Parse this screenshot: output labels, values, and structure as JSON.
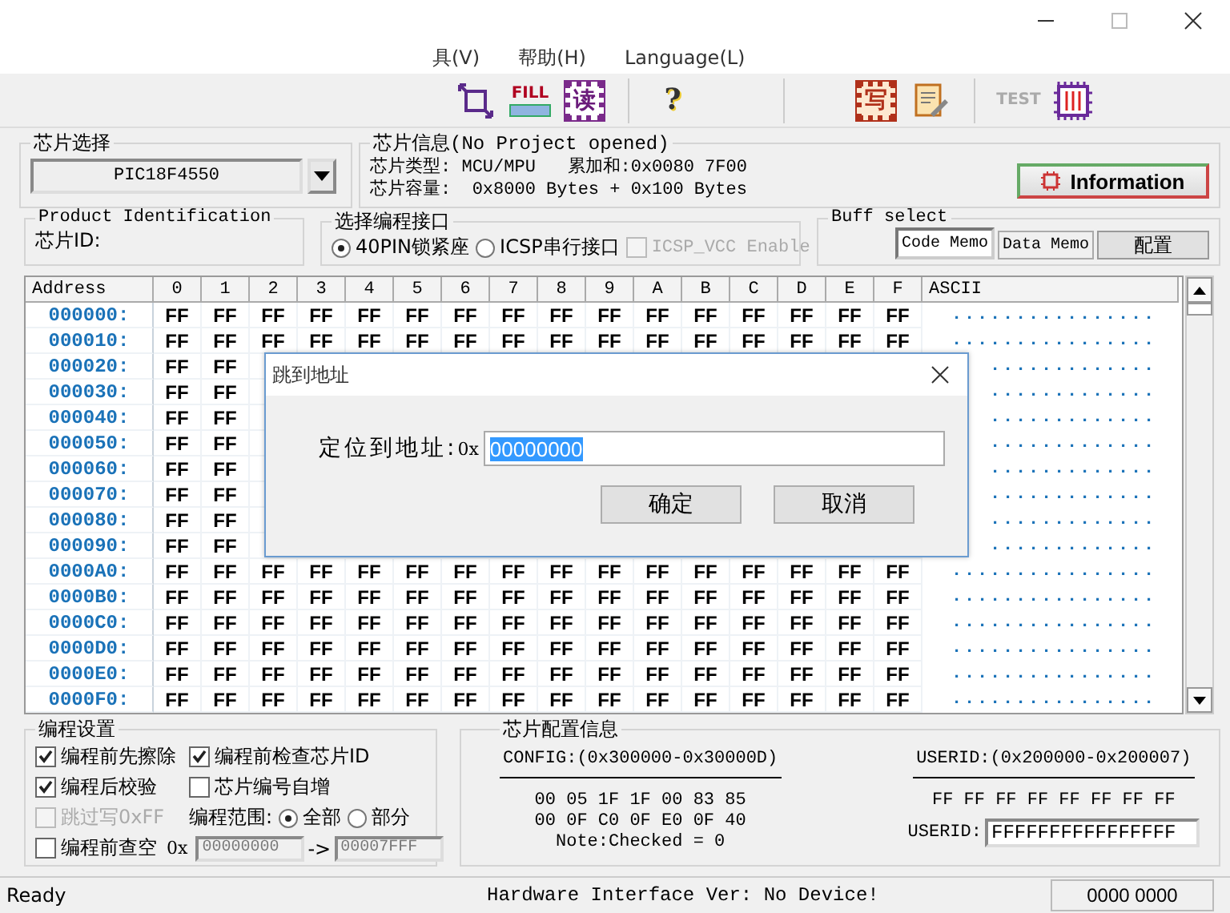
{
  "menu": [
    "具(V)",
    "帮助(H)",
    "Language(L)"
  ],
  "toolbar": [
    {
      "kind": "chip-arrows"
    },
    {
      "kind": "fill",
      "label": "FILL"
    },
    {
      "kind": "read",
      "label": "读"
    },
    {
      "kind": "help",
      "label": "?"
    },
    {
      "kind": "write",
      "label": "写"
    },
    {
      "kind": "edit"
    },
    {
      "kind": "test",
      "label": "TEST",
      "disabled": true
    },
    {
      "kind": "chip"
    }
  ],
  "chip_select": {
    "title": "芯片选择",
    "value": "PIC18F4550"
  },
  "chip_info": {
    "title": "芯片信息(No Project opened)",
    "type_label": "芯片类型:",
    "type_value": "MCU/MPU",
    "checksum": "累加和:0x0080 7F00",
    "capacity_label": "芯片容量:",
    "capacity_value": "0x8000 Bytes + 0x100 Bytes",
    "button": "Information"
  },
  "product_id": {
    "title": "Product Identification",
    "label": "芯片ID:"
  },
  "interface": {
    "title": "选择编程接口",
    "options": [
      {
        "label": "40PIN锁紧座",
        "selected": true
      },
      {
        "label": "ICSP串行接口",
        "selected": false
      }
    ],
    "vcc": {
      "label": "ICSP_VCC Enable",
      "checked": false,
      "disabled": true
    }
  },
  "buff_select": {
    "title": "Buff select",
    "tabs": [
      {
        "label": "Code Memo",
        "selected": true
      },
      {
        "label": "Data Memo",
        "selected": false
      }
    ],
    "button": "配置"
  },
  "hex_table": {
    "columns": [
      "Address",
      "0",
      "1",
      "2",
      "3",
      "4",
      "5",
      "6",
      "7",
      "8",
      "9",
      "A",
      "B",
      "C",
      "D",
      "E",
      "F",
      "ASCII"
    ],
    "rows": [
      {
        "cells": [
          "000000:",
          "FF",
          "FF",
          "FF",
          "FF",
          "FF",
          "FF",
          "FF",
          "FF",
          "FF",
          "FF",
          "FF",
          "FF",
          "FF",
          "FF",
          "FF",
          "FF",
          "................"
        ]
      },
      {
        "cells": [
          "000010:",
          "FF",
          "FF",
          "FF",
          "FF",
          "FF",
          "FF",
          "FF",
          "FF",
          "FF",
          "FF",
          "FF",
          "FF",
          "FF",
          "FF",
          "FF",
          "FF",
          "................"
        ]
      },
      {
        "cells": [
          "000020:",
          "FF",
          "FF",
          null,
          null,
          null,
          null,
          null,
          null,
          null,
          null,
          null,
          null,
          null,
          null,
          null,
          null,
          "............."
        ]
      },
      {
        "cells": [
          "000030:",
          "FF",
          "FF",
          null,
          null,
          null,
          null,
          null,
          null,
          null,
          null,
          null,
          null,
          null,
          null,
          null,
          null,
          "............."
        ]
      },
      {
        "cells": [
          "000040:",
          "FF",
          "FF",
          null,
          null,
          null,
          null,
          null,
          null,
          null,
          null,
          null,
          null,
          null,
          null,
          null,
          null,
          "............."
        ]
      },
      {
        "cells": [
          "000050:",
          "FF",
          "FF",
          null,
          null,
          null,
          null,
          null,
          null,
          null,
          null,
          null,
          null,
          null,
          null,
          null,
          null,
          "............."
        ]
      },
      {
        "cells": [
          "000060:",
          "FF",
          "FF",
          null,
          null,
          null,
          null,
          null,
          null,
          null,
          null,
          null,
          null,
          null,
          null,
          null,
          null,
          "............."
        ]
      },
      {
        "cells": [
          "000070:",
          "FF",
          "FF",
          null,
          null,
          null,
          null,
          null,
          null,
          null,
          null,
          null,
          null,
          null,
          null,
          null,
          null,
          "............."
        ]
      },
      {
        "cells": [
          "000080:",
          "FF",
          "FF",
          null,
          null,
          null,
          null,
          null,
          null,
          null,
          null,
          null,
          null,
          null,
          null,
          null,
          null,
          "............."
        ]
      },
      {
        "cells": [
          "000090:",
          "FF",
          "FF",
          null,
          null,
          null,
          null,
          null,
          null,
          null,
          null,
          null,
          null,
          null,
          null,
          null,
          null,
          "............."
        ]
      },
      {
        "cells": [
          "0000A0:",
          "FF",
          "FF",
          "FF",
          "FF",
          "FF",
          "FF",
          "FF",
          "FF",
          "FF",
          "FF",
          "FF",
          "FF",
          "FF",
          "FF",
          "FF",
          "FF",
          "................"
        ]
      },
      {
        "cells": [
          "0000B0:",
          "FF",
          "FF",
          "FF",
          "FF",
          "FF",
          "FF",
          "FF",
          "FF",
          "FF",
          "FF",
          "FF",
          "FF",
          "FF",
          "FF",
          "FF",
          "FF",
          "................"
        ]
      },
      {
        "cells": [
          "0000C0:",
          "FF",
          "FF",
          "FF",
          "FF",
          "FF",
          "FF",
          "FF",
          "FF",
          "FF",
          "FF",
          "FF",
          "FF",
          "FF",
          "FF",
          "FF",
          "FF",
          "................"
        ]
      },
      {
        "cells": [
          "0000D0:",
          "FF",
          "FF",
          "FF",
          "FF",
          "FF",
          "FF",
          "FF",
          "FF",
          "FF",
          "FF",
          "FF",
          "FF",
          "FF",
          "FF",
          "FF",
          "FF",
          "................"
        ]
      },
      {
        "cells": [
          "0000E0:",
          "FF",
          "FF",
          "FF",
          "FF",
          "FF",
          "FF",
          "FF",
          "FF",
          "FF",
          "FF",
          "FF",
          "FF",
          "FF",
          "FF",
          "FF",
          "FF",
          "................"
        ]
      },
      {
        "cells": [
          "0000F0:",
          "FF",
          "FF",
          "FF",
          "FF",
          "FF",
          "FF",
          "FF",
          "FF",
          "FF",
          "FF",
          "FF",
          "FF",
          "FF",
          "FF",
          "FF",
          "FF",
          "................"
        ]
      }
    ]
  },
  "dialog": {
    "title": "跳到地址",
    "label": "定位到地址:",
    "prefix": "0x",
    "value": "00000000",
    "buttons": [
      "确定",
      "取消"
    ]
  },
  "prog_settings": {
    "title": "编程设置",
    "left_checks": [
      {
        "label": "编程前先擦除",
        "checked": true,
        "disabled": false
      },
      {
        "label": "编程后校验",
        "checked": true,
        "disabled": false
      },
      {
        "label": "跳过写0xFF",
        "checked": false,
        "disabled": true
      },
      {
        "label": "编程前查空",
        "checked": false,
        "disabled": false
      }
    ],
    "right_checks": [
      {
        "label": "编程前检查芯片ID",
        "checked": true,
        "disabled": false
      },
      {
        "label": "芯片编号自增",
        "checked": false,
        "disabled": false
      }
    ],
    "range_label": "编程范围:",
    "range_options": [
      {
        "label": "全部",
        "selected": true
      },
      {
        "label": "部分",
        "selected": false
      }
    ],
    "range_prefix": "0x",
    "range_from": "00000000",
    "range_arrow": "->",
    "range_to": "00007FFF"
  },
  "config_info": {
    "title": "芯片配置信息",
    "config_header": "CONFIG:(0x300000-0x30000D)",
    "config_lines": [
      "00 05 1F 1F 00 83 85",
      "00 0F C0 0F E0 0F 40",
      "Note:Checked = 0"
    ],
    "userid_header": "USERID:(0x200000-0x200007)",
    "userid_bytes": "FF FF FF FF FF FF FF FF",
    "userid_label": "USERID:",
    "userid_value": "FFFFFFFFFFFFFFFF"
  },
  "status_bar": [
    "Ready",
    "Hardware Interface Ver: No Device!",
    "0000 0000"
  ]
}
